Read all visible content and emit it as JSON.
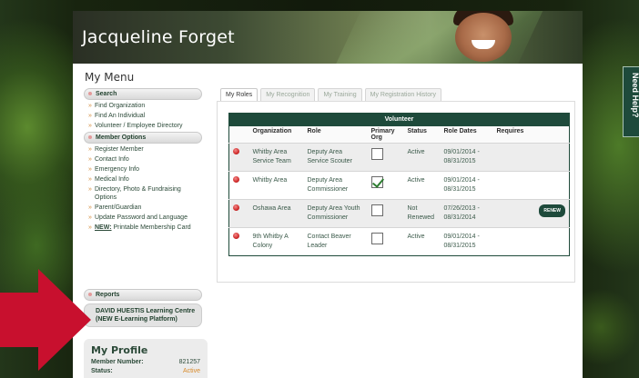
{
  "header": {
    "name": "Jacqueline Forget"
  },
  "menu": {
    "title": "My Menu",
    "search_label": "Search",
    "search_items": [
      "Find Organization",
      "Find An Individual",
      "Volunteer / Employee Directory"
    ],
    "member_options_label": "Member Options",
    "member_items": [
      "Register Member",
      "Contact Info",
      "Emergency Info",
      "Medical Info",
      "Directory, Photo & Fundraising Options",
      "Parent/Guardian",
      "Update Password and Language"
    ],
    "new_tag": "NEW:",
    "new_item": " Printable Membership Card",
    "reports_label": "Reports",
    "learning_label": "DAVID HUESTIS Learning Centre (NEW E-Learning Platform)"
  },
  "profile": {
    "title": "My Profile",
    "member_number_label": "Member Number:",
    "member_number": "821257",
    "status_label": "Status:",
    "status": "Active"
  },
  "tabs": [
    "My Roles",
    "My Recognition",
    "My Training",
    "My Registration History"
  ],
  "table": {
    "group_header": "Volunteer",
    "columns": [
      "Organization",
      "Role",
      "Primary Org",
      "Status",
      "Role Dates",
      "Requires"
    ],
    "rows": [
      {
        "organization": "Whitby Area Service Team",
        "role": "Deputy Area Service Scouter",
        "primary": false,
        "status": "Active",
        "dates": "09/01/2014 - 08/31/2015",
        "requires": ""
      },
      {
        "organization": "Whitby Area",
        "role": "Deputy Area Commissioner",
        "primary": true,
        "status": "Active",
        "dates": "09/01/2014 - 08/31/2015",
        "requires": ""
      },
      {
        "organization": "Oshawa Area",
        "role": "Deputy Area Youth Commissioner",
        "primary": false,
        "status": "Not Renewed",
        "dates": "07/26/2013 - 08/31/2014",
        "requires": "RENEW"
      },
      {
        "organization": "9th Whitby A Colony",
        "role": "Contact Beaver Leader",
        "primary": false,
        "status": "Active",
        "dates": "09/01/2014 - 08/31/2015",
        "requires": ""
      }
    ]
  },
  "help_tab": "Need Help?",
  "colors": {
    "brand_green": "#1e4a3b",
    "alert_red": "#d12a2a",
    "arrow_red": "#c8102e",
    "accent_orange": "#d48c3c"
  }
}
